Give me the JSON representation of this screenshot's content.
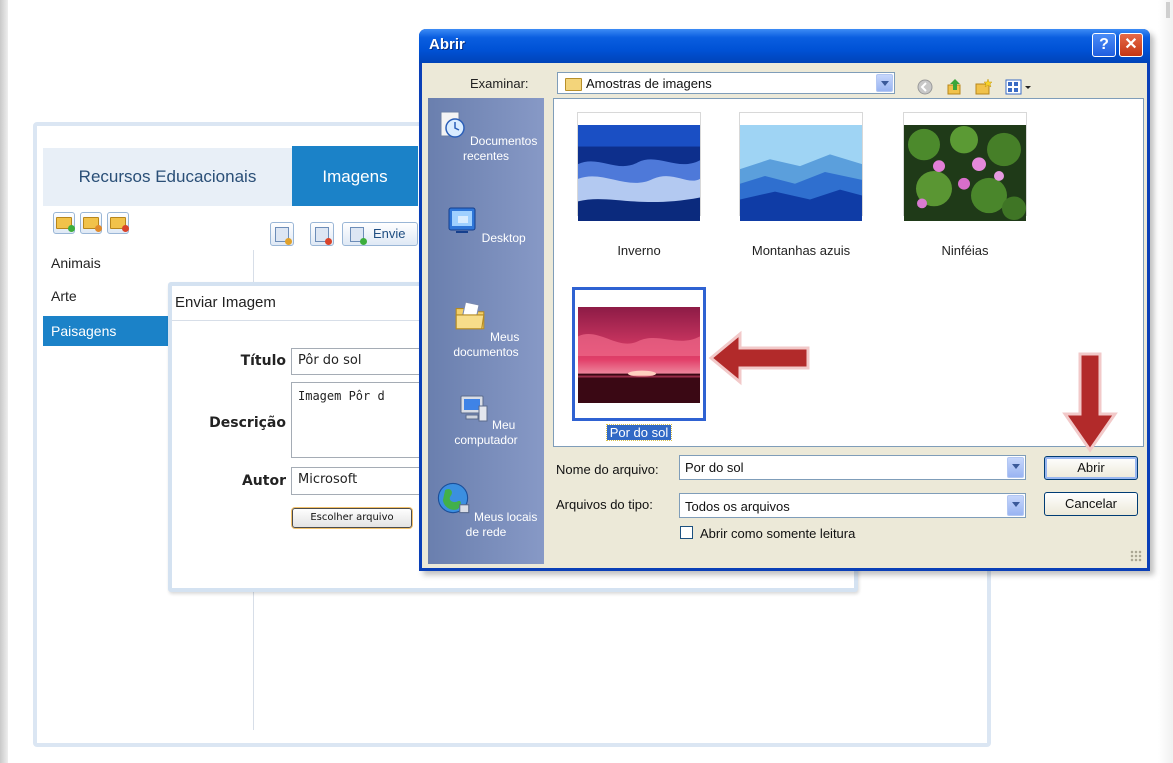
{
  "web_app": {
    "tabs": [
      {
        "label": "Recursos Educacionais"
      },
      {
        "label": "Imagens"
      }
    ],
    "toolbar": {
      "send_label": "Envie"
    },
    "categories": [
      "Animais",
      "Arte",
      "Paisagens"
    ],
    "selected_category": "Paisagens"
  },
  "upload_dialog": {
    "title": "Enviar Imagem",
    "fields": {
      "titulo_label": "Título",
      "titulo_value": "Pôr do sol",
      "descricao_label": "Descrição",
      "descricao_value": "Imagem Pôr d",
      "autor_label": "Autor",
      "autor_value": "Microsoft"
    },
    "choose_file_label": "Escolher arquivo"
  },
  "open_dialog": {
    "title": "Abrir",
    "help_label": "?",
    "close_label": "✕",
    "look_in_label": "Examinar:",
    "look_in_value": "Amostras de imagens",
    "places": [
      {
        "label": "Documentos recentes",
        "icon": "recent-documents-icon"
      },
      {
        "label": "Desktop",
        "icon": "desktop-icon"
      },
      {
        "label": "Meus documentos",
        "icon": "my-documents-icon"
      },
      {
        "label": "Meu computador",
        "icon": "my-computer-icon"
      },
      {
        "label": "Meus locais de rede",
        "icon": "network-places-icon"
      }
    ],
    "files": [
      {
        "name": "Inverno"
      },
      {
        "name": "Montanhas azuis"
      },
      {
        "name": "Ninféias"
      },
      {
        "name": "Por do sol",
        "selected": true
      }
    ],
    "file_name_label": "Nome do arquivo:",
    "file_name_value": "Por do sol",
    "file_type_label": "Arquivos do tipo:",
    "file_type_value": "Todos os arquivos",
    "readonly_label": "Abrir como somente leitura",
    "readonly_checked": false,
    "open_label": "Abrir",
    "cancel_label": "Cancelar"
  },
  "colors": {
    "xp_title_blue": "#0052d6",
    "tab_active": "#1b82c8",
    "annotation_arrow": "#b22a2a",
    "selection_blue": "#3169c6"
  }
}
